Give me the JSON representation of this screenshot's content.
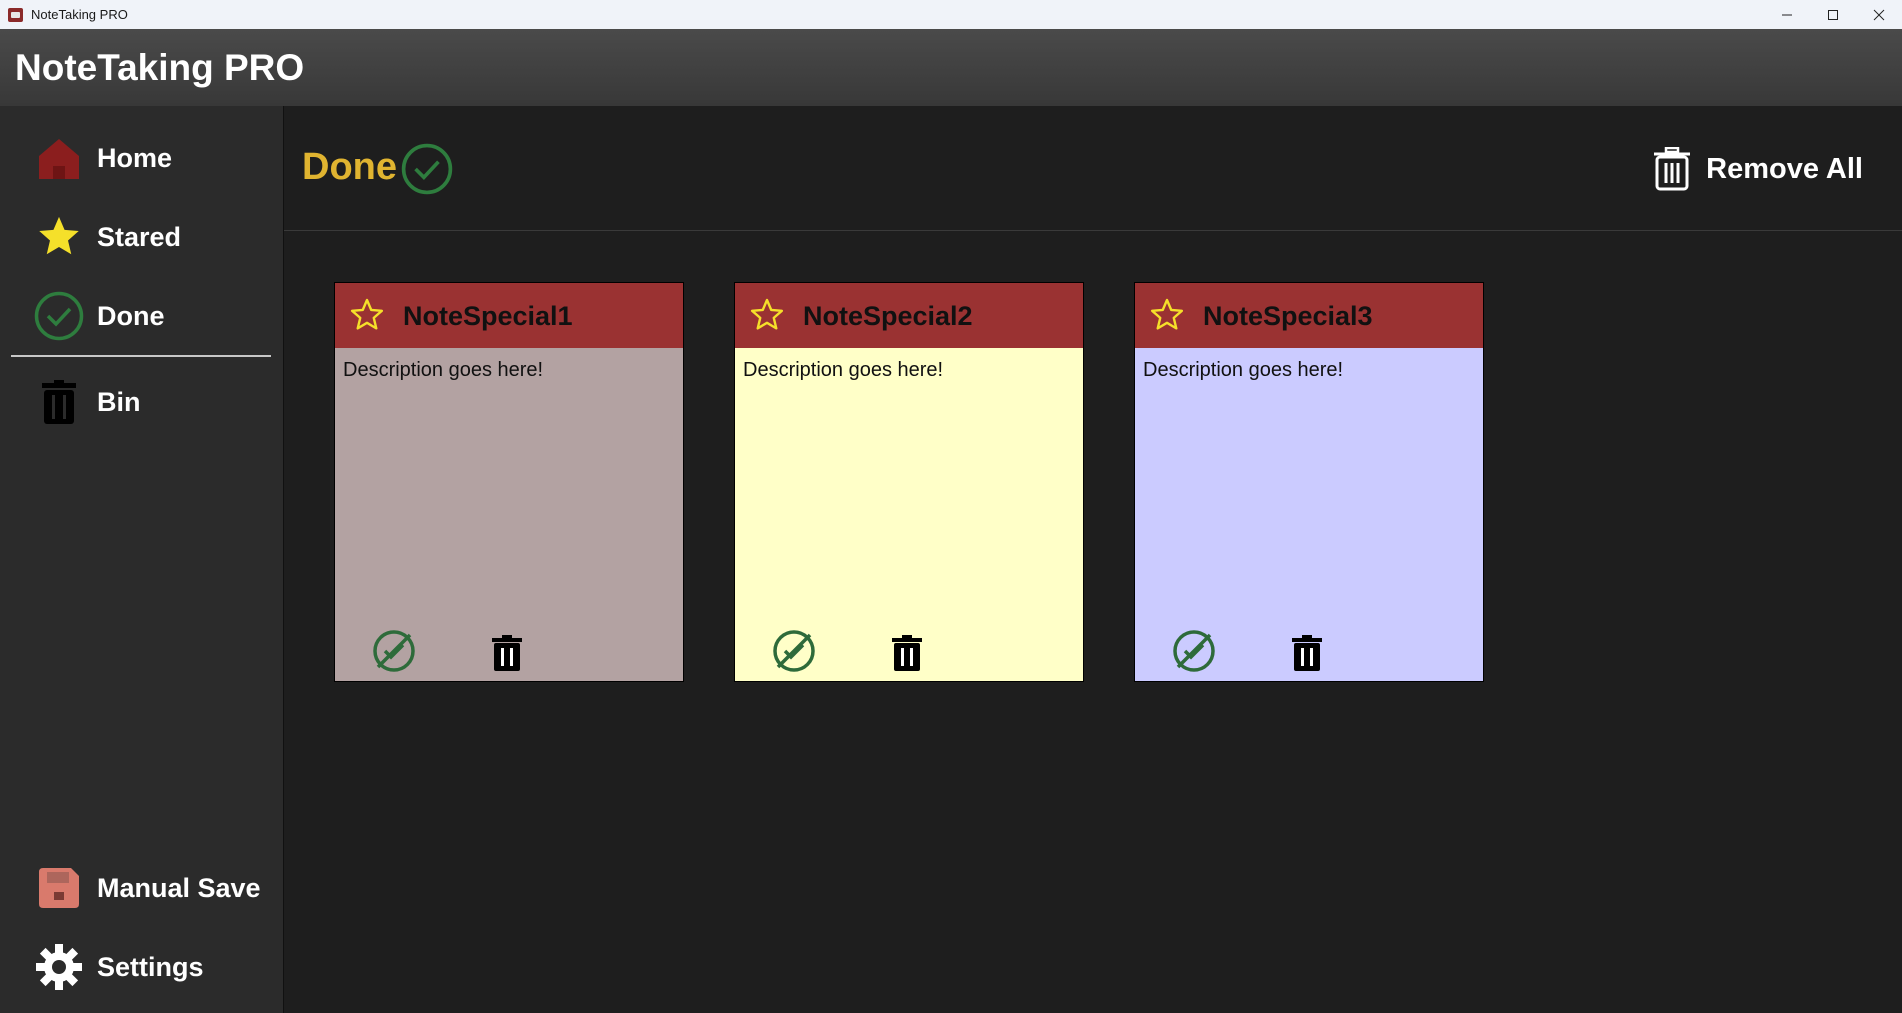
{
  "window": {
    "title": "NoteTaking PRO",
    "controls": {
      "minimize_icon": "minimize-icon",
      "maximize_icon": "maximize-icon",
      "close_icon": "close-icon"
    }
  },
  "header": {
    "app_title": "NoteTaking PRO"
  },
  "sidebar": {
    "items": [
      {
        "label": "Home",
        "icon": "home-icon"
      },
      {
        "label": "Stared",
        "icon": "star-icon"
      },
      {
        "label": "Done",
        "icon": "check-circle-icon"
      },
      {
        "label": "Bin",
        "icon": "trash-icon"
      }
    ],
    "bottom_items": [
      {
        "label": "Manual Save",
        "icon": "save-icon"
      },
      {
        "label": "Settings",
        "icon": "gear-icon"
      }
    ]
  },
  "main": {
    "page_title": "Done",
    "remove_all_label": "Remove All",
    "notes": [
      {
        "title": "NoteSpecial1",
        "description": "Description goes here!",
        "color": "#b3a2a2"
      },
      {
        "title": "NoteSpecial2",
        "description": "Description goes here!",
        "color": "#ffffc8"
      },
      {
        "title": "NoteSpecial3",
        "description": "Description goes here!",
        "color": "#cbcbff"
      }
    ]
  },
  "colors": {
    "header_bg": "#404040",
    "sidebar_bg": "#2b2b2b",
    "main_bg": "#1e1e1e",
    "accent_title": "#e0b430",
    "note_header": "#9a3232",
    "done_green": "#2e7d3e",
    "star_yellow": "#f5e02a",
    "home_red": "#8b1e1e",
    "save_salmon": "#d97a6c"
  }
}
